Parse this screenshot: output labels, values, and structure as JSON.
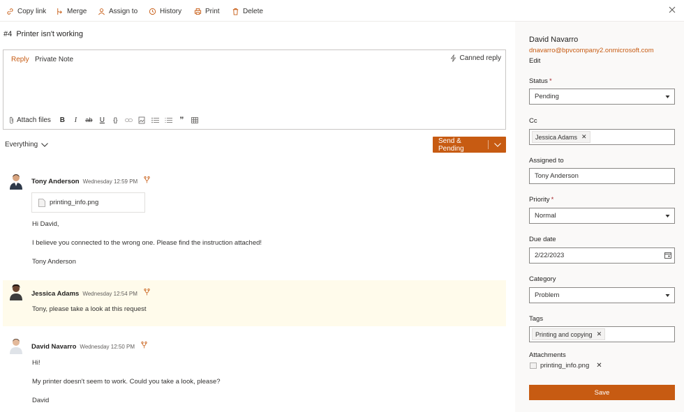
{
  "toolbar": {
    "copy_link": "Copy link",
    "merge": "Merge",
    "assign_to": "Assign to",
    "history": "History",
    "print": "Print",
    "delete": "Delete"
  },
  "ticket": {
    "number": "#4",
    "title": "Printer isn't working"
  },
  "reply": {
    "tab_reply": "Reply",
    "tab_private": "Private Note",
    "canned": "Canned reply",
    "attach_files": "Attach files"
  },
  "filter": {
    "label": "Everything"
  },
  "send_button": {
    "label": "Send & Pending"
  },
  "messages": [
    {
      "author": "Tony Anderson",
      "time": "Wednesday 12:59 PM",
      "attachment": "printing_info.png",
      "lines": [
        "Hi David,",
        "I believe you connected to the wrong one. Please find the instruction attached!",
        "Tony Anderson"
      ]
    },
    {
      "author": "Jessica Adams",
      "time": "Wednesday 12:54 PM",
      "lines": [
        "Tony, please take a look at this request"
      ]
    },
    {
      "author": "David Navarro",
      "time": "Wednesday 12:50 PM",
      "lines": [
        "Hi!",
        "My printer doesn't seem to work. Could you take a look, please?",
        "David"
      ]
    }
  ],
  "details": {
    "requester_name": "David Navarro",
    "requester_email": "dnavarro@bpvcompany2.onmicrosoft.com",
    "edit": "Edit",
    "status_label": "Status",
    "status_value": "Pending",
    "cc_label": "Cc",
    "cc_value": "Jessica Adams",
    "assigned_label": "Assigned to",
    "assigned_value": "Tony Anderson",
    "priority_label": "Priority",
    "priority_value": "Normal",
    "due_label": "Due date",
    "due_value": "2/22/2023",
    "category_label": "Category",
    "category_value": "Problem",
    "tags_label": "Tags",
    "tags_value": "Printing and copying",
    "attachments_label": "Attachments",
    "attachment_file": "printing_info.png",
    "required_mark": "*",
    "save": "Save"
  },
  "colors": {
    "accent": "#c75b12",
    "highlight": "#fffbeb",
    "panel": "#faf9f8"
  }
}
